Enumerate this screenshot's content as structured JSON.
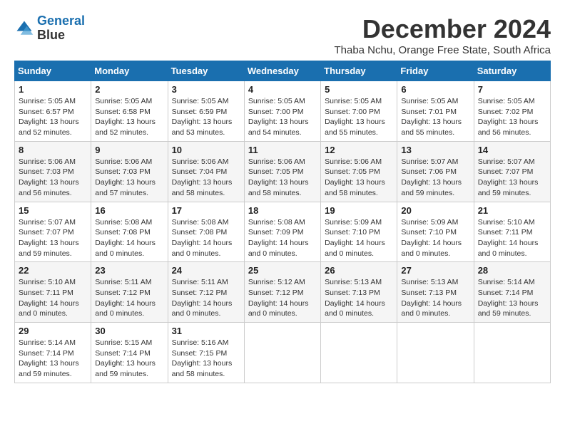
{
  "logo": {
    "line1": "General",
    "line2": "Blue"
  },
  "title": "December 2024",
  "location": "Thaba Nchu, Orange Free State, South Africa",
  "days_header": [
    "Sunday",
    "Monday",
    "Tuesday",
    "Wednesday",
    "Thursday",
    "Friday",
    "Saturday"
  ],
  "weeks": [
    [
      {
        "day": "1",
        "info": "Sunrise: 5:05 AM\nSunset: 6:57 PM\nDaylight: 13 hours\nand 52 minutes."
      },
      {
        "day": "2",
        "info": "Sunrise: 5:05 AM\nSunset: 6:58 PM\nDaylight: 13 hours\nand 52 minutes."
      },
      {
        "day": "3",
        "info": "Sunrise: 5:05 AM\nSunset: 6:59 PM\nDaylight: 13 hours\nand 53 minutes."
      },
      {
        "day": "4",
        "info": "Sunrise: 5:05 AM\nSunset: 7:00 PM\nDaylight: 13 hours\nand 54 minutes."
      },
      {
        "day": "5",
        "info": "Sunrise: 5:05 AM\nSunset: 7:00 PM\nDaylight: 13 hours\nand 55 minutes."
      },
      {
        "day": "6",
        "info": "Sunrise: 5:05 AM\nSunset: 7:01 PM\nDaylight: 13 hours\nand 55 minutes."
      },
      {
        "day": "7",
        "info": "Sunrise: 5:05 AM\nSunset: 7:02 PM\nDaylight: 13 hours\nand 56 minutes."
      }
    ],
    [
      {
        "day": "8",
        "info": "Sunrise: 5:06 AM\nSunset: 7:03 PM\nDaylight: 13 hours\nand 56 minutes."
      },
      {
        "day": "9",
        "info": "Sunrise: 5:06 AM\nSunset: 7:03 PM\nDaylight: 13 hours\nand 57 minutes."
      },
      {
        "day": "10",
        "info": "Sunrise: 5:06 AM\nSunset: 7:04 PM\nDaylight: 13 hours\nand 58 minutes."
      },
      {
        "day": "11",
        "info": "Sunrise: 5:06 AM\nSunset: 7:05 PM\nDaylight: 13 hours\nand 58 minutes."
      },
      {
        "day": "12",
        "info": "Sunrise: 5:06 AM\nSunset: 7:05 PM\nDaylight: 13 hours\nand 58 minutes."
      },
      {
        "day": "13",
        "info": "Sunrise: 5:07 AM\nSunset: 7:06 PM\nDaylight: 13 hours\nand 59 minutes."
      },
      {
        "day": "14",
        "info": "Sunrise: 5:07 AM\nSunset: 7:07 PM\nDaylight: 13 hours\nand 59 minutes."
      }
    ],
    [
      {
        "day": "15",
        "info": "Sunrise: 5:07 AM\nSunset: 7:07 PM\nDaylight: 13 hours\nand 59 minutes."
      },
      {
        "day": "16",
        "info": "Sunrise: 5:08 AM\nSunset: 7:08 PM\nDaylight: 14 hours\nand 0 minutes."
      },
      {
        "day": "17",
        "info": "Sunrise: 5:08 AM\nSunset: 7:08 PM\nDaylight: 14 hours\nand 0 minutes."
      },
      {
        "day": "18",
        "info": "Sunrise: 5:08 AM\nSunset: 7:09 PM\nDaylight: 14 hours\nand 0 minutes."
      },
      {
        "day": "19",
        "info": "Sunrise: 5:09 AM\nSunset: 7:10 PM\nDaylight: 14 hours\nand 0 minutes."
      },
      {
        "day": "20",
        "info": "Sunrise: 5:09 AM\nSunset: 7:10 PM\nDaylight: 14 hours\nand 0 minutes."
      },
      {
        "day": "21",
        "info": "Sunrise: 5:10 AM\nSunset: 7:11 PM\nDaylight: 14 hours\nand 0 minutes."
      }
    ],
    [
      {
        "day": "22",
        "info": "Sunrise: 5:10 AM\nSunset: 7:11 PM\nDaylight: 14 hours\nand 0 minutes."
      },
      {
        "day": "23",
        "info": "Sunrise: 5:11 AM\nSunset: 7:12 PM\nDaylight: 14 hours\nand 0 minutes."
      },
      {
        "day": "24",
        "info": "Sunrise: 5:11 AM\nSunset: 7:12 PM\nDaylight: 14 hours\nand 0 minutes."
      },
      {
        "day": "25",
        "info": "Sunrise: 5:12 AM\nSunset: 7:12 PM\nDaylight: 14 hours\nand 0 minutes."
      },
      {
        "day": "26",
        "info": "Sunrise: 5:13 AM\nSunset: 7:13 PM\nDaylight: 14 hours\nand 0 minutes."
      },
      {
        "day": "27",
        "info": "Sunrise: 5:13 AM\nSunset: 7:13 PM\nDaylight: 14 hours\nand 0 minutes."
      },
      {
        "day": "28",
        "info": "Sunrise: 5:14 AM\nSunset: 7:14 PM\nDaylight: 13 hours\nand 59 minutes."
      }
    ],
    [
      {
        "day": "29",
        "info": "Sunrise: 5:14 AM\nSunset: 7:14 PM\nDaylight: 13 hours\nand 59 minutes."
      },
      {
        "day": "30",
        "info": "Sunrise: 5:15 AM\nSunset: 7:14 PM\nDaylight: 13 hours\nand 59 minutes."
      },
      {
        "day": "31",
        "info": "Sunrise: 5:16 AM\nSunset: 7:15 PM\nDaylight: 13 hours\nand 58 minutes."
      },
      {
        "day": "",
        "info": ""
      },
      {
        "day": "",
        "info": ""
      },
      {
        "day": "",
        "info": ""
      },
      {
        "day": "",
        "info": ""
      }
    ]
  ]
}
